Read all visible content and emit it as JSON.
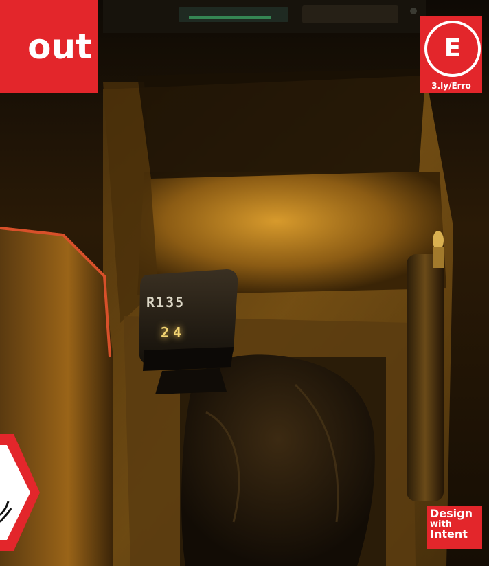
{
  "title_banner": {
    "text": "out"
  },
  "category_badge": {
    "letter": "E",
    "url": "3.ly/Erro"
  },
  "knob_labels": {
    "top_row": "R135",
    "bottom_row": "24"
  },
  "corner_badge": {
    "line1": "Design",
    "line2": "with",
    "line3": "Intent"
  },
  "colors": {
    "brand_red": "#e3262b",
    "ambient_amber": "#d89a2a"
  }
}
